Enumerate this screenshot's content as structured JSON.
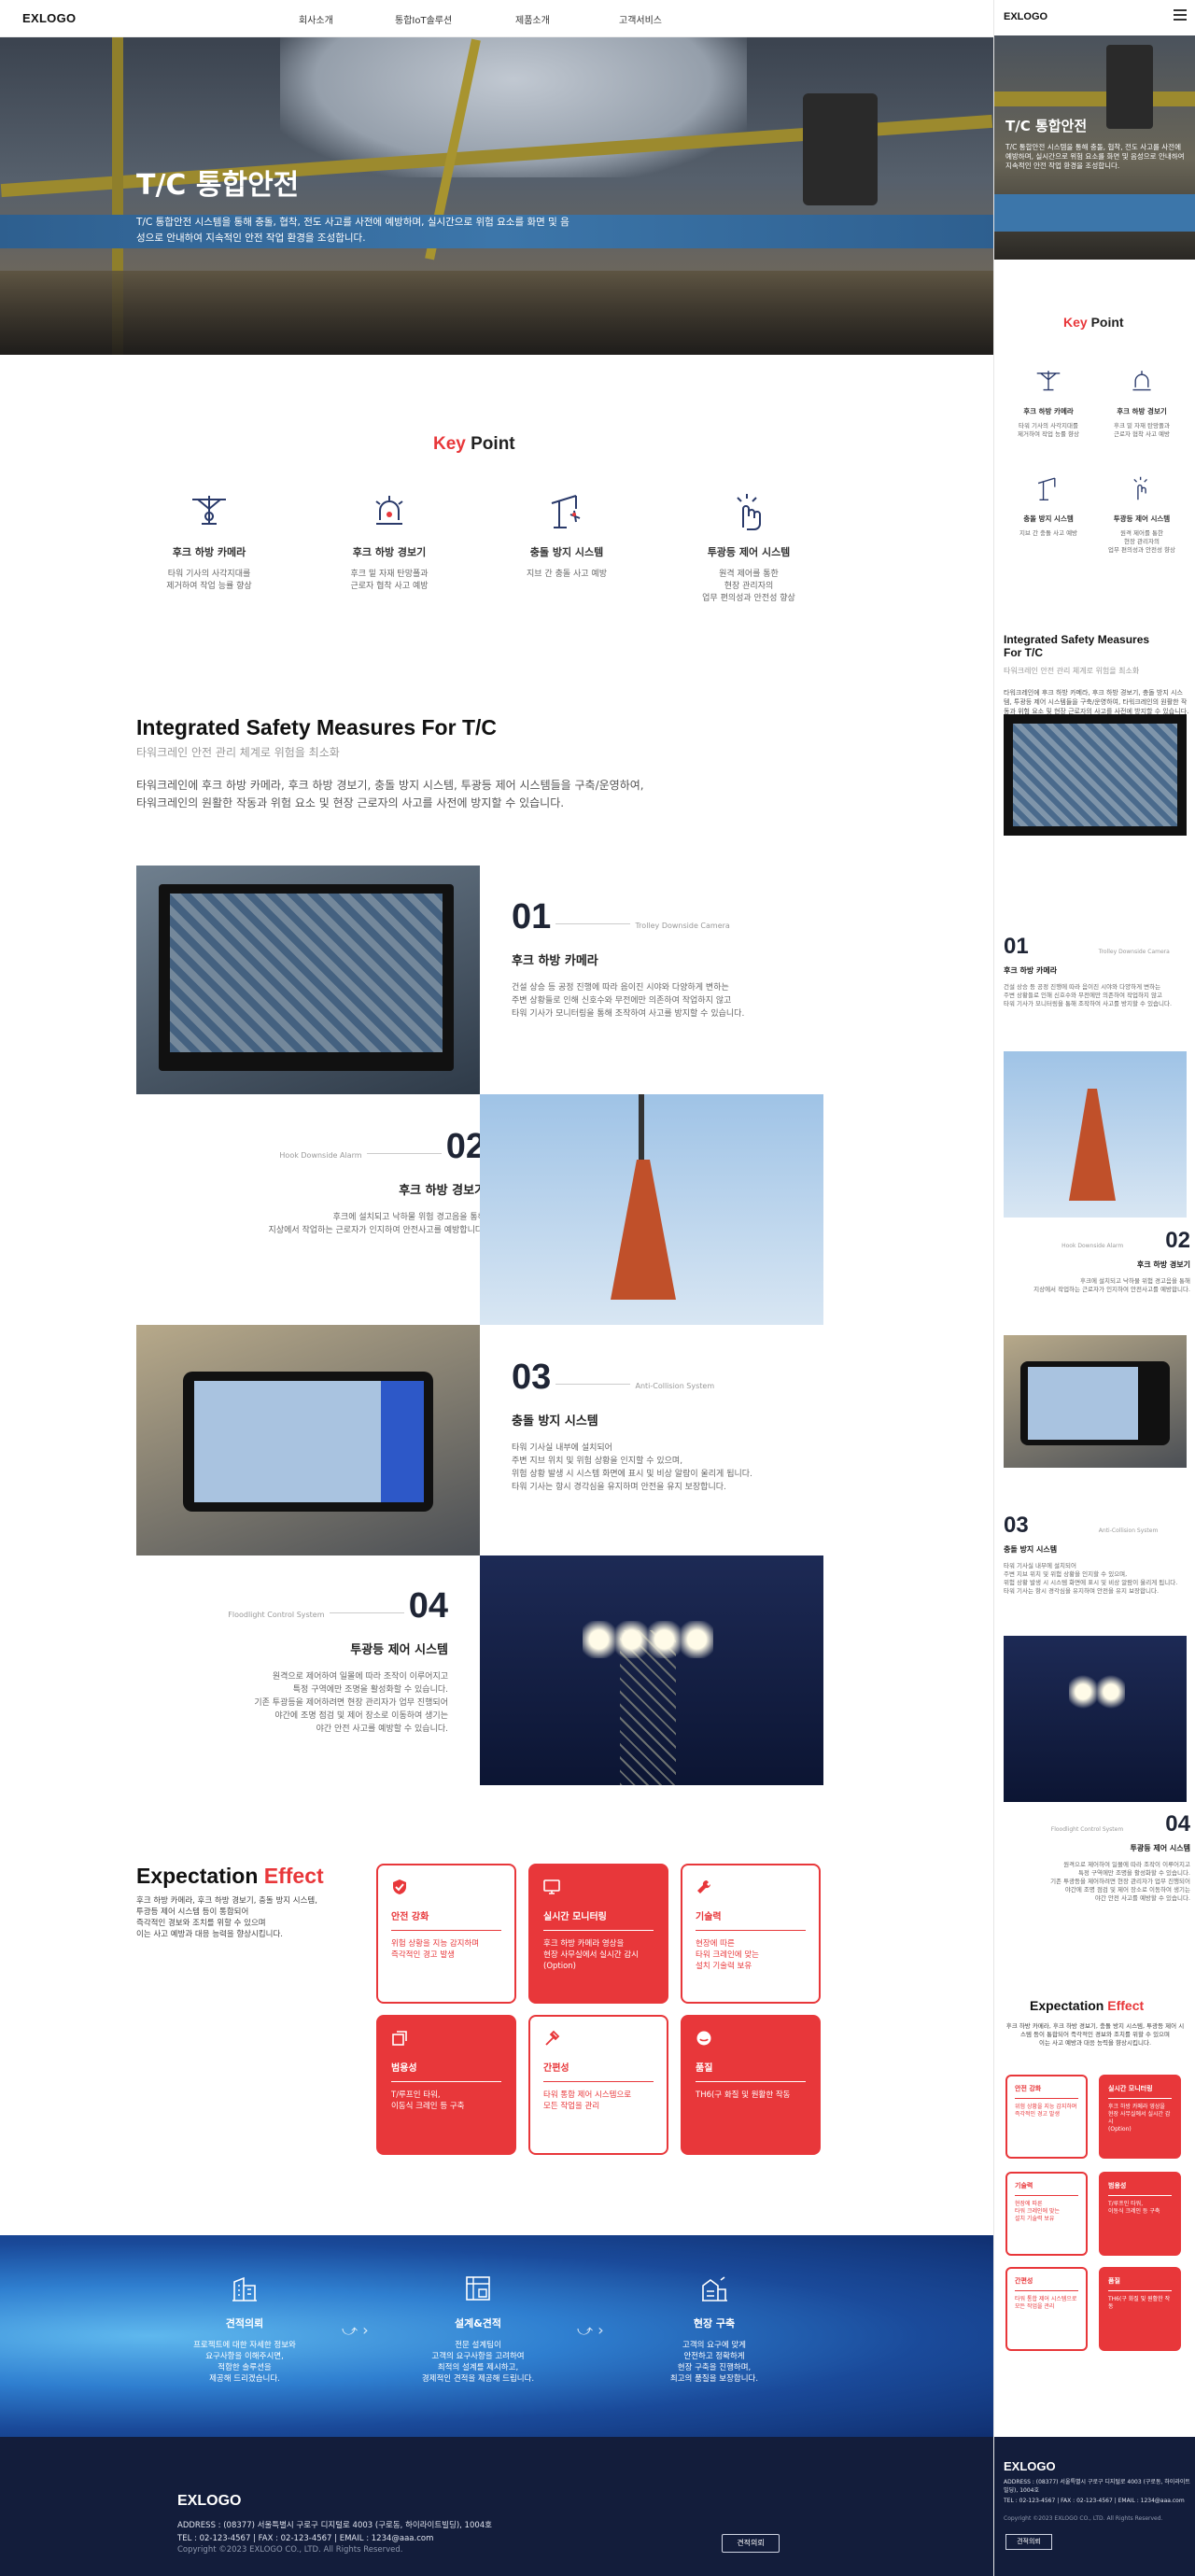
{
  "nav": {
    "logo": "EXLOGO",
    "menu": [
      "회사소개",
      "통합IoT솔루션",
      "제품소개",
      "고객서비스"
    ]
  },
  "hero": {
    "title": "T/C 통합안전",
    "desc": "T/C 통합안전 시스템을 통해 충돌, 협착, 전도 사고를 사전에 예방하며, 실시간으로 위험 요소를 화면 및 음성으로 안내하여 지속적인 안전 작업 환경을 조성합니다."
  },
  "keypoint": {
    "title_red": "Key",
    "title_rest": " Point",
    "items": [
      {
        "icon": "hook-camera-icon",
        "title": "후크 하방 카메라",
        "desc": "타워 기사의 사각지대를\n제거하여 작업 능률 향상"
      },
      {
        "icon": "alarm-beacon-icon",
        "title": "후크 하방 경보기",
        "desc": "후크 밑 자재 탄망폴과\n근로자 협착 사고 예방"
      },
      {
        "icon": "crane-collision-icon",
        "title": "충돌 방지 시스템",
        "desc": "지브 간 충돌 사고 예방"
      },
      {
        "icon": "floodlight-control-icon",
        "title": "투광등 제어 시스템",
        "desc": "원격 제어를 통한\n현장 관리자의\n업무 편의성과 안전성 향상"
      }
    ]
  },
  "ism": {
    "title": "Integrated Safety Measures For T/C",
    "subtitle": "타워크레인 안전 관리 체계로 위험을 최소화",
    "desc": "타워크레인에 후크 하방 카메라, 후크 하방 경보기, 충돌 방지 시스템, 투광등 제어 시스템들을 구축/운영하여,\n타워크레인의 원활한 작동과 위험 요소 및 현장 근로자의 사고를 사전에 방지할 수 있습니다."
  },
  "features": [
    {
      "num": "01",
      "en": "Trolley Downside Camera",
      "title": "후크 하방 카메라",
      "desc": "건설 상승 등 공정 진행에 따라 음이진 시야와 다양하게 변하는\n주변 상황들로 인해 신호수와 무전에만 의존하여 작업하지 않고\n타워 기사가 모니터링을 통해 조작하여 사고를 방지할 수 있습니다."
    },
    {
      "num": "02",
      "en": "Hook Downside Alarm",
      "title": "후크 하방 경보기",
      "desc": "후크에 설치되고 낙하물 위험 경고음을 통해\n지상에서 작업하는 근로자가 인지하여 안전사고를 예방합니다."
    },
    {
      "num": "03",
      "en": "Anti-Collision System",
      "title": "충돌 방지 시스템",
      "desc": "타워 기사실 내부에 설치되어\n주변 지브 위치 및 위험 상황을 인지할 수 있으며,\n위험 상황 발생 시 시스템 화면에 표시 및 비상 알람이 울리게 됩니다.\n타워 기사는 항시 경각심을 유지하며 안전을 유지 보장합니다."
    },
    {
      "num": "04",
      "en": "Floodlight Control System",
      "title": "투광등 제어 시스템",
      "desc": "원격으로 제어하여 일몰에 따라 조작이 이루어지고\n특정 구역에만 조명을 활성화할 수 있습니다.\n기존 투광등을 제어하려면 현장 관리자가 업무 진행되어\n야간에 조명 점검 및 제어 장소로 이동하여 생기는\n야간 안전 사고를 예방할 수 있습니다."
    }
  ],
  "expect": {
    "title": "Expectation",
    "title_red": " Effect",
    "desc": "후크 하방 카메라, 후크 하방 경보기, 충돌 방지 시스템,\n투광등 제어 시스템 등이 통합되어\n즉각적인 경보와 조치를 위할 수 있으며\n이는 사고 예방과 대응 능력을 향상시킵니다.",
    "cards": [
      {
        "style": "w",
        "icon": "shield-check-icon",
        "title": "안전 강화",
        "desc": "위험 상황을 지능 감지하며\n즉각적인 경고 발생"
      },
      {
        "style": "r",
        "icon": "monitor-icon",
        "title": "실시간 모니터링",
        "desc": "후크 하방 카메라 영상을\n현장 사무실에서 실시간 감시\n(Option)"
      },
      {
        "style": "w",
        "icon": "wrench-icon",
        "title": "기술력",
        "desc": "현장에 따른\n타워 크레인에 맞는\n설치 기술력 보유"
      },
      {
        "style": "r",
        "icon": "versatility-icon",
        "title": "범용성",
        "desc": "T/루프인 타워,\n이동식 크레인 등 구축"
      },
      {
        "style": "w",
        "icon": "convenience-icon",
        "title": "간편성",
        "desc": "타워 통합 제어 시스템으로\n모든 작업을 관리"
      },
      {
        "style": "r",
        "icon": "quality-icon",
        "title": "품질",
        "desc": "TH6(구 화질 및 원활한 작동"
      }
    ]
  },
  "process": {
    "steps": [
      {
        "icon": "building-icon",
        "title": "견적의뢰",
        "desc": "프로젝트에 대한 자세한 정보와\n요구사항을 이해주시면,\n적합한 솔루션을\n제공해 드리겠습니다."
      },
      {
        "icon": "blueprint-icon",
        "title": "설계&견적",
        "desc": "전문 설계팀이\n고객의 요구사항을 고려하여\n최적의 설계를 제시하고,\n경제적인 견적을 제공해 드립니다."
      },
      {
        "icon": "construction-icon",
        "title": "현장 구축",
        "desc": "고객의 요구에 맞게\n안전하고 정확하게\n현장 구축을 진행하며,\n최고의 품질을 보장합니다."
      }
    ]
  },
  "footer": {
    "logo": "EXLOGO",
    "address": "ADDRESS : (08377) 서울특별시 구로구 디지털로 4003 (구로동, 하이라이트빌딩), 1004호",
    "contact": "TEL : 02-123-4567 | FAX : 02-123-4567 | EMAIL : 1234@aaa.com",
    "copyright": "Copyright ©2023 EXLOGO CO., LTD. All Rights Reserved.",
    "button": "견적의뢰"
  },
  "mobile": {
    "logo": "EXLOGO",
    "hero_title": "T/C 통합안전",
    "hero_desc": "T/C 통합안전 시스템을 통해 충돌, 협착, 전도 사고를 사전에 예방하며, 실시간으로 위험 요소를 화면 및 음성으로 안내하여 지속적인 안전 작업 환경을 조성합니다.",
    "keypoint": [
      {
        "title": "후크 하방 카메라",
        "desc": "타워 기사의 사각지대를\n제거하여 작업 능률 향상"
      },
      {
        "title": "후크 하방 경보기",
        "desc": "후크 밑 자재 탄망폴과\n근로자 협착 사고 예방"
      },
      {
        "title": "충돌 방지 시스템",
        "desc": "지브 간 충돌 사고 예방"
      },
      {
        "title": "투광등 제어 시스템",
        "desc": "원격 제어를 통한\n현장 관리자의\n업무 편의성과 안전성 향상"
      }
    ],
    "ism_title": "Integrated Safety Measures\nFor T/C",
    "ism_sub": "타워크레인 안전 관리 체계로 위험을 최소화",
    "ism_desc": "타워크레인에 후크 하방 카메라, 후크 하방 경보기, 충돌 방지 시스템, 투광등 제어 시스템들을 구축/운영하여, 타워크레인의 원활한 작동과 위험 요소 및 현장 근로자의 사고를 사전에 방지할 수 있습니다.",
    "expect_desc": "후크 하방 카메라, 후크 하방 경보기, 충돌 방지 시스템, 투광등 제어 시스템 등이 통합되어 즉각적인 경보와 조치를 위할 수 있으며\n이는 사고 예방과 대응 능력을 향상시킵니다.",
    "footer_address": "ADDRESS : (08377) 서울특별시 구로구 디지털로 4003 (구로동, 하이라이트빌딩), 1004호",
    "footer_contact": "TEL : 02-123-4567 | FAX : 02-123-4567 | EMAIL : 1234@aaa.com",
    "footer_copy": "Copyright ©2023 EXLOGO CO., LTD. All Rights Reserved."
  },
  "colors": {
    "accent": "#e8373a",
    "navy": "#131d3b"
  }
}
